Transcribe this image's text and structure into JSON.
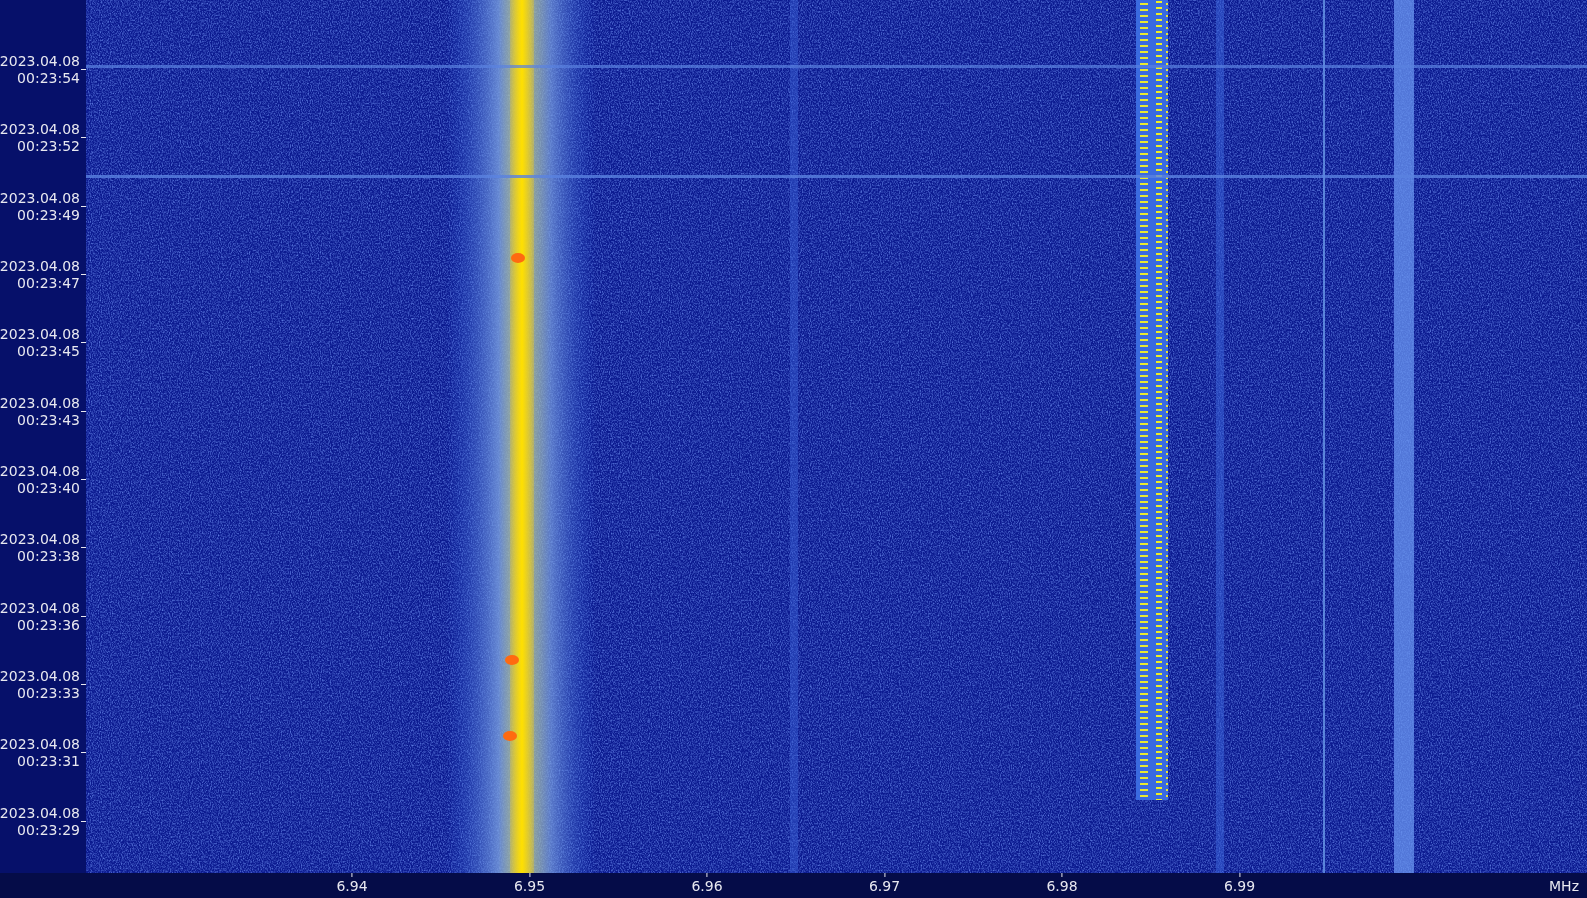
{
  "time_axis": {
    "labels": [
      {
        "date": "2023.04.08",
        "time": "00:23:54"
      },
      {
        "date": "2023.04.08",
        "time": "00:23:52"
      },
      {
        "date": "2023.04.08",
        "time": "00:23:49"
      },
      {
        "date": "2023.04.08",
        "time": "00:23:47"
      },
      {
        "date": "2023.04.08",
        "time": "00:23:45"
      },
      {
        "date": "2023.04.08",
        "time": "00:23:43"
      },
      {
        "date": "2023.04.08",
        "time": "00:23:40"
      },
      {
        "date": "2023.04.08",
        "time": "00:23:38"
      },
      {
        "date": "2023.04.08",
        "time": "00:23:36"
      },
      {
        "date": "2023.04.08",
        "time": "00:23:33"
      },
      {
        "date": "2023.04.08",
        "time": "00:23:31"
      },
      {
        "date": "2023.04.08",
        "time": "00:23:29"
      }
    ]
  },
  "frequency_axis": {
    "ticks": [
      "6.94",
      "6.95",
      "6.96",
      "6.97",
      "6.98",
      "6.99"
    ],
    "unit": "MHz"
  }
}
